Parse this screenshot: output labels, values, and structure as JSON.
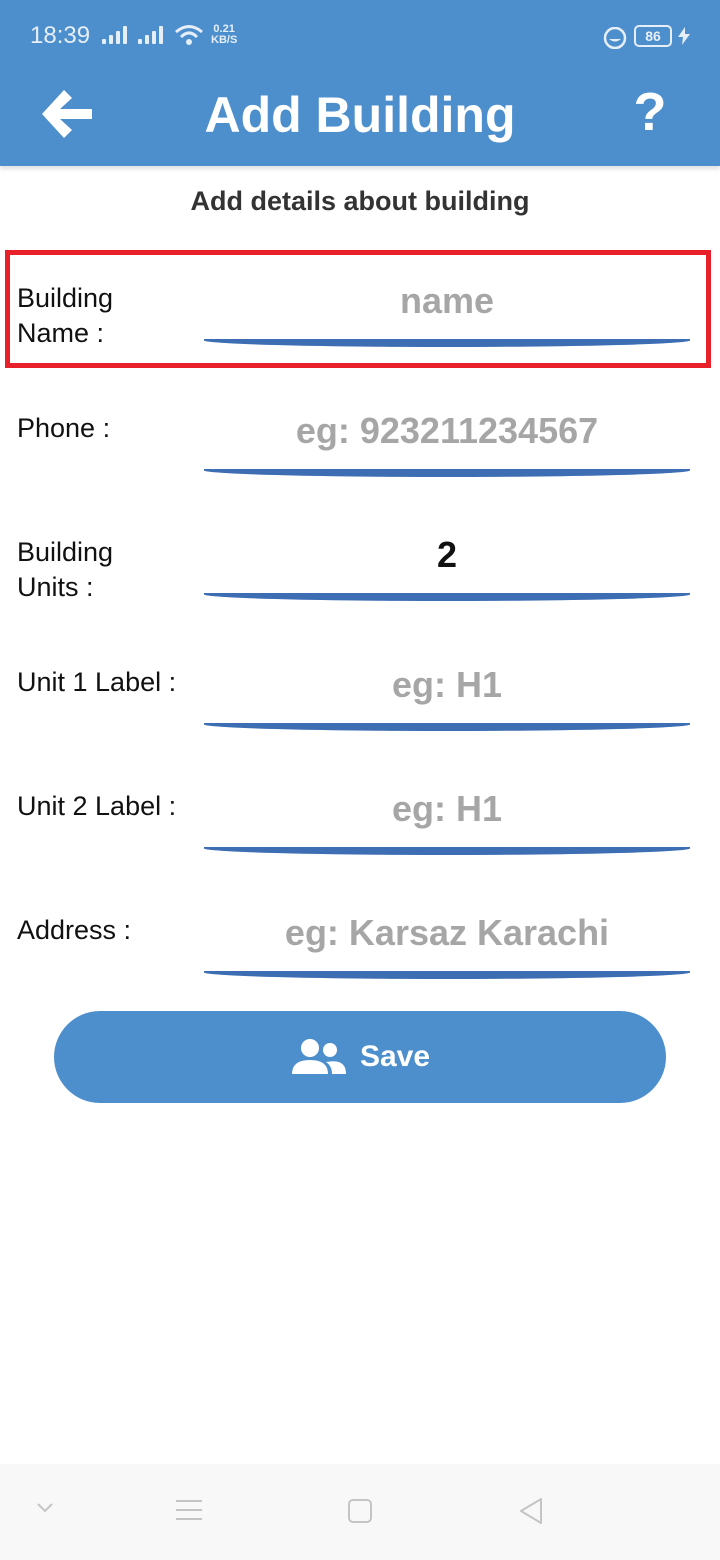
{
  "status_bar": {
    "time": "18:39",
    "net_speed_value": "0.21",
    "net_speed_unit": "KB/S",
    "battery": "86"
  },
  "app_bar": {
    "title": "Add Building",
    "back_icon": "arrow-left-icon",
    "help_label": "?"
  },
  "form": {
    "subtitle": "Add details about building",
    "fields": [
      {
        "label_line1": "Building",
        "label_line2": "Name :",
        "value": "",
        "placeholder": "name"
      },
      {
        "label_line1": "Phone :",
        "value": "",
        "placeholder": "eg: 923211234567"
      },
      {
        "label_line1": "Building",
        "label_line2": "Units :",
        "value": "2",
        "placeholder": ""
      },
      {
        "label_line1": "Unit 1 Label :",
        "value": "",
        "placeholder": "eg: H1"
      },
      {
        "label_line1": "Unit 2 Label :",
        "value": "",
        "placeholder": "eg: H1"
      },
      {
        "label_line1": "Address :",
        "value": "",
        "placeholder": "eg: Karsaz Karachi"
      }
    ],
    "save_label": "Save",
    "save_icon": "users-icon"
  },
  "colors": {
    "primary": "#4d8fcc",
    "underline": "#3d6eb3",
    "highlight": "#e8202a",
    "placeholder": "#a6a6a6"
  }
}
